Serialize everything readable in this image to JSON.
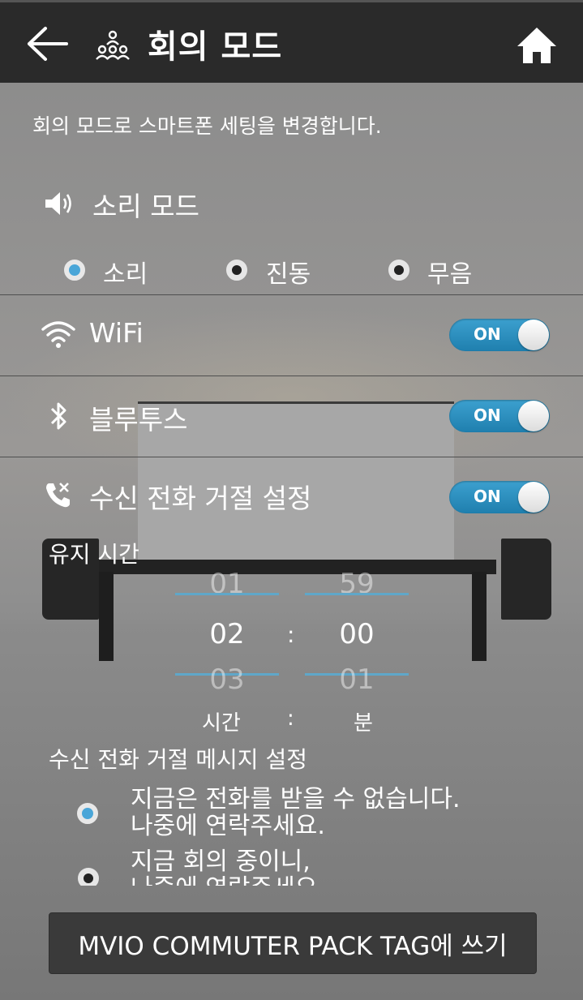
{
  "header": {
    "title": "회의 모드",
    "back_icon": "arrow-left-icon",
    "title_icon": "people-group-icon",
    "home_icon": "home-icon"
  },
  "description": "회의 모드로 스마트폰 세팅을 변경합니다.",
  "sound_mode": {
    "title": "소리 모드",
    "icon": "speaker-icon",
    "options": [
      {
        "label": "소리",
        "selected": true
      },
      {
        "label": "진동",
        "selected": false
      },
      {
        "label": "무음",
        "selected": false
      }
    ]
  },
  "wifi": {
    "label": "WiFi",
    "icon": "wifi-icon",
    "toggle": "ON"
  },
  "bluetooth": {
    "label": "블루투스",
    "icon": "bluetooth-icon",
    "toggle": "ON"
  },
  "call_reject": {
    "label": "수신 전화 거절 설정",
    "icon": "phone-reject-icon",
    "toggle": "ON"
  },
  "duration": {
    "label": "유지 시간",
    "hours": {
      "prev": "01",
      "current": "02",
      "next": "03"
    },
    "minutes": {
      "prev": "59",
      "current": "00",
      "next": "01"
    },
    "separator": ":",
    "hour_unit": "시간",
    "minute_unit": "분"
  },
  "reject_message": {
    "label": "수신 전화 거절 메시지 설정",
    "options": [
      {
        "line1": "지금은 전화를 받을 수 없습니다.",
        "line2": "나중에 연락주세요.",
        "selected": true
      },
      {
        "line1": "지금 회의 중이니,",
        "line2": "나중에 연락주세요.",
        "selected": false
      }
    ]
  },
  "bottom_button": "MVIO COMMUTER PACK TAG에 쓰기",
  "colors": {
    "accent": "#3ca0cf",
    "topbar": "#2a2a2a",
    "button": "#3a3a3a"
  }
}
